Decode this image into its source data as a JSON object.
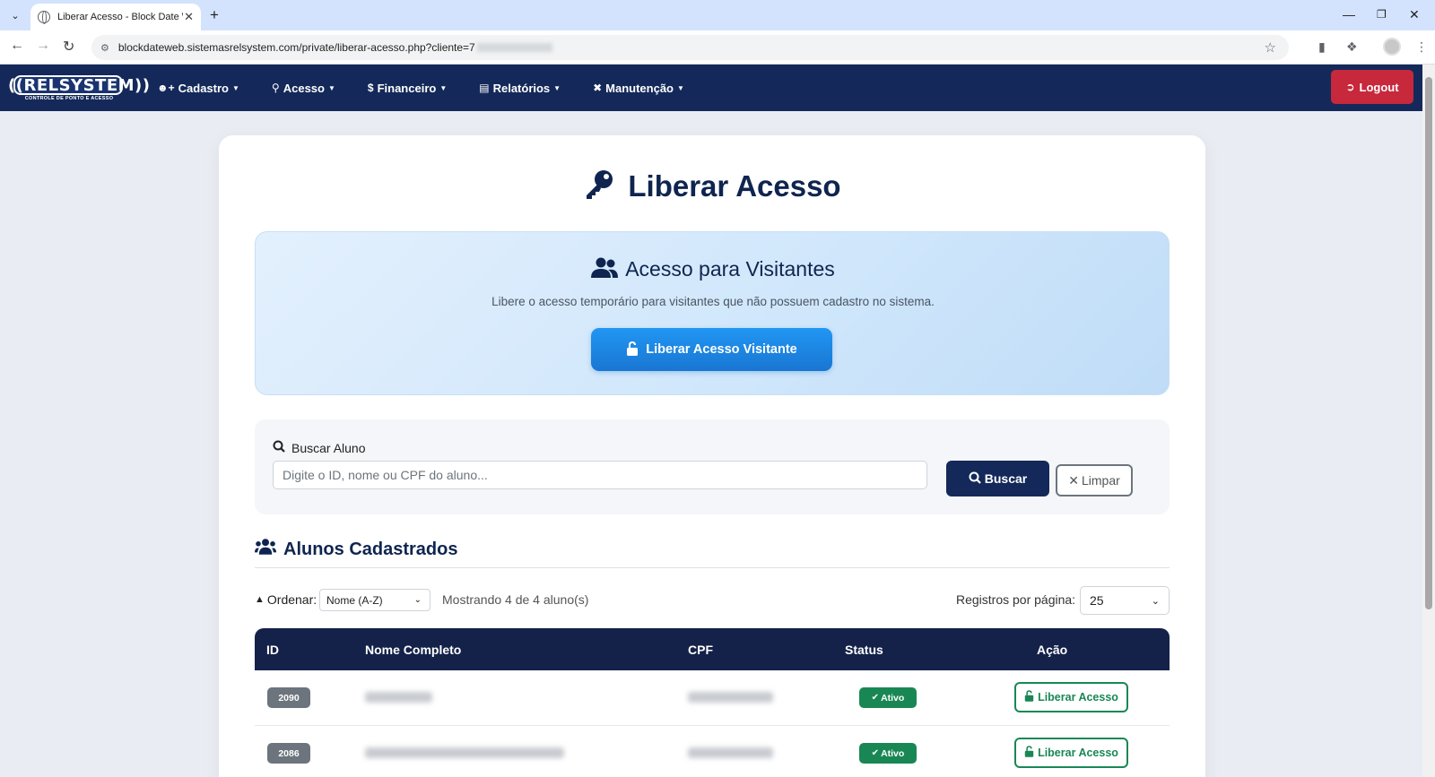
{
  "browser": {
    "tab_title": "Liberar Acesso - Block Date We",
    "url": "blockdateweb.sistemasrelsystem.com/private/liberar-acesso.php?cliente=7"
  },
  "navbar": {
    "logo_text": "((RELSYSTEM))",
    "logo_subtext": "CONTROLE DE PONTO E ACESSO",
    "menu": [
      {
        "label": "Cadastro",
        "icon": "user-plus-icon"
      },
      {
        "label": "Acesso",
        "icon": "key-icon"
      },
      {
        "label": "Financeiro",
        "icon": "dollar-icon"
      },
      {
        "label": "Relatórios",
        "icon": "chart-icon"
      },
      {
        "label": "Manutenção",
        "icon": "tools-icon"
      }
    ],
    "logout_label": "Logout"
  },
  "page": {
    "title": "Liberar Acesso"
  },
  "visitor": {
    "title": "Acesso para Visitantes",
    "description": "Libere o acesso temporário para visitantes que não possuem cadastro no sistema.",
    "button_label": "Liberar Acesso Visitante"
  },
  "search": {
    "label": "Buscar Aluno",
    "placeholder": "Digite o ID, nome ou CPF do aluno...",
    "value": "",
    "search_button": "Buscar",
    "clear_button": "Limpar"
  },
  "students": {
    "section_title": "Alunos Cadastrados",
    "order_label": "Ordenar:",
    "order_value": "Nome (A-Z)",
    "showing_text": "Mostrando 4 de 4 aluno(s)",
    "per_page_label": "Registros por página:",
    "per_page_value": "25",
    "columns": [
      "ID",
      "Nome Completo",
      "CPF",
      "Status",
      "Ação"
    ],
    "rows": [
      {
        "id": "2090",
        "status": "Ativo",
        "action": "Liberar Acesso"
      },
      {
        "id": "2086",
        "status": "Ativo",
        "action": "Liberar Acesso"
      }
    ]
  },
  "colors": {
    "navbar": "#14295a",
    "logout": "#c8283c",
    "primary_blue": "#1976d2",
    "success": "#198754",
    "table_header": "#14224a"
  }
}
